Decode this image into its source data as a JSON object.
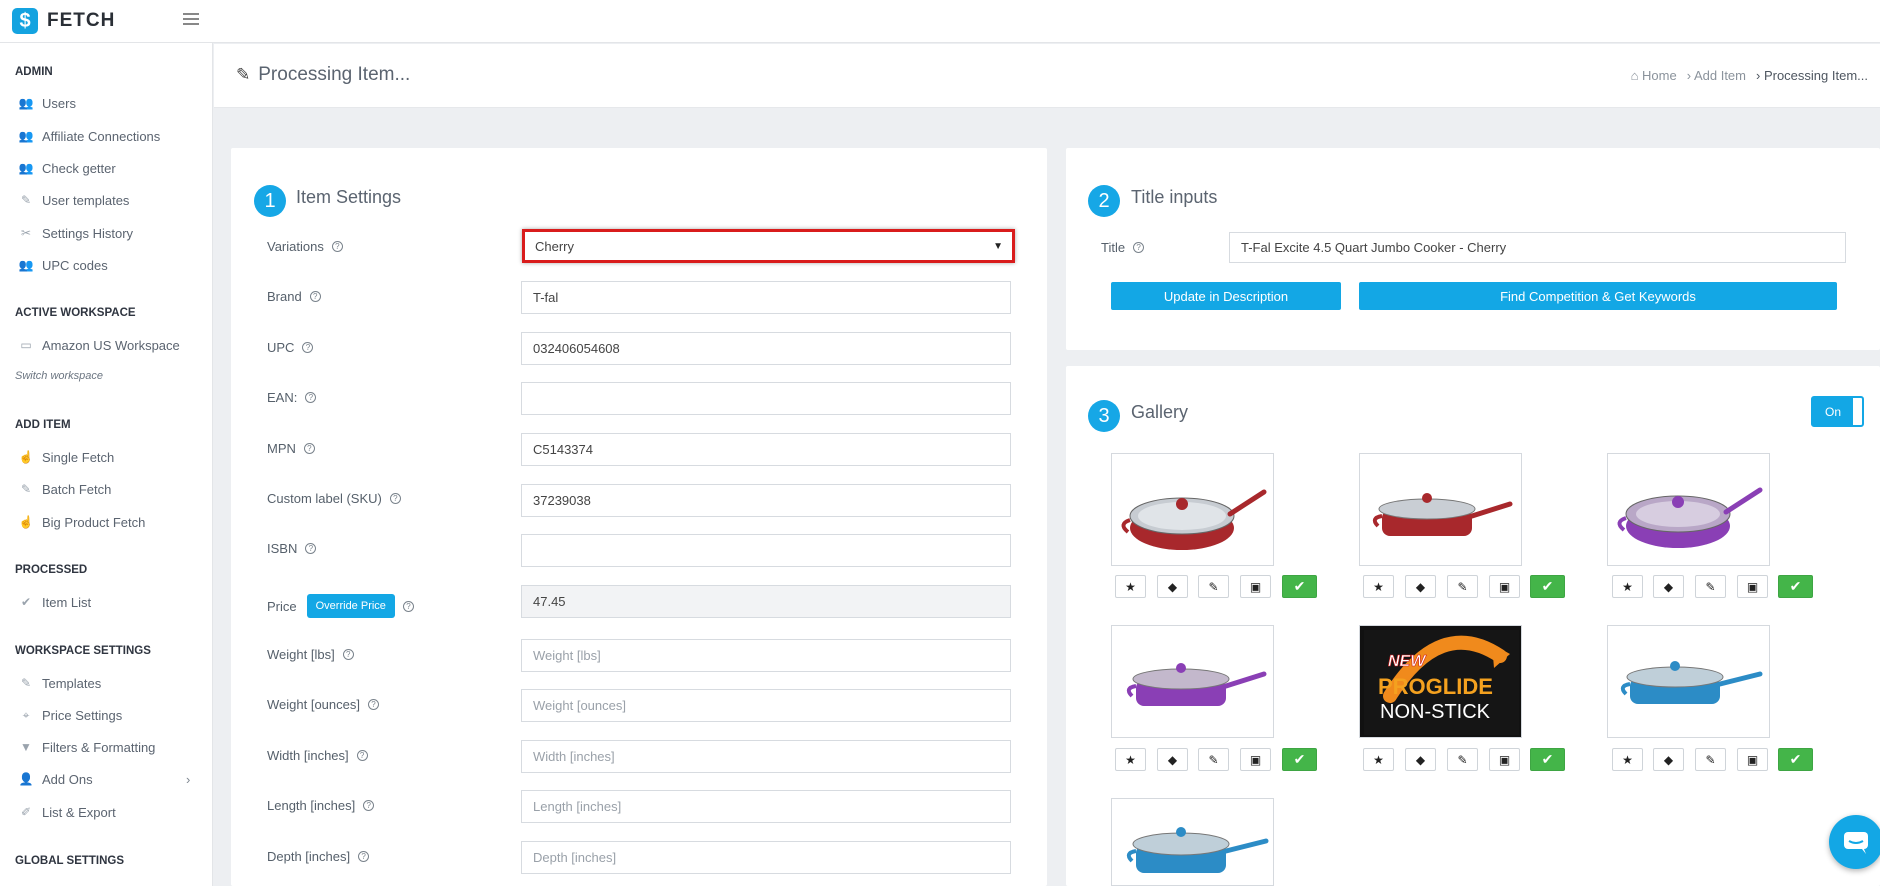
{
  "app": {
    "logo_letter": "$",
    "logo_text": "FETCH"
  },
  "sidebar": {
    "sections": [
      {
        "label": "ADMIN"
      },
      {
        "label": "ACTIVE WORKSPACE"
      },
      {
        "label": "ADD ITEM"
      },
      {
        "label": "PROCESSED"
      },
      {
        "label": "WORKSPACE SETTINGS"
      },
      {
        "label": "GLOBAL SETTINGS"
      }
    ],
    "items": [
      {
        "label": "Users",
        "icon": "users-icon"
      },
      {
        "label": "Affiliate Connections",
        "icon": "users-icon"
      },
      {
        "label": "Check getter",
        "icon": "users-icon"
      },
      {
        "label": "User templates",
        "icon": "brush-icon"
      },
      {
        "label": "Settings History",
        "icon": "tools-icon"
      },
      {
        "label": "UPC codes",
        "icon": "users-icon"
      },
      {
        "label": "Amazon US Workspace",
        "icon": "monitor-icon"
      },
      {
        "label": "Single Fetch",
        "icon": "hand-icon"
      },
      {
        "label": "Batch Fetch",
        "icon": "brush-icon"
      },
      {
        "label": "Big Product Fetch",
        "icon": "hand-icon"
      },
      {
        "label": "Item List",
        "icon": "check-list-icon"
      },
      {
        "label": "Templates",
        "icon": "brush-icon"
      },
      {
        "label": "Price Settings",
        "icon": "tag-icon"
      },
      {
        "label": "Filters & Formatting",
        "icon": "filter-icon"
      },
      {
        "label": "Add Ons",
        "icon": "user-icon"
      },
      {
        "label": "List & Export",
        "icon": "export-icon"
      }
    ],
    "switch_workspace": "Switch workspace"
  },
  "header": {
    "title": "Processing Item...",
    "breadcrumbs": [
      "Home",
      "Add Item",
      "Processing Item..."
    ]
  },
  "item_settings": {
    "step": "1",
    "title": "Item Settings",
    "override_label": "Override Price",
    "fields": [
      {
        "label": "Variations",
        "value": "Cherry"
      },
      {
        "label": "Brand",
        "value": "T-fal"
      },
      {
        "label": "UPC",
        "value": "032406054608"
      },
      {
        "label": "EAN:",
        "value": ""
      },
      {
        "label": "MPN",
        "value": "C5143374"
      },
      {
        "label": "Custom label (SKU)",
        "value": "37239038"
      },
      {
        "label": "ISBN",
        "value": ""
      },
      {
        "label": "Price",
        "value": "47.45"
      },
      {
        "label": "Weight [lbs]",
        "placeholder": "Weight [lbs]"
      },
      {
        "label": "Weight [ounces]",
        "placeholder": "Weight [ounces]"
      },
      {
        "label": "Width [inches]",
        "placeholder": "Width [inches]"
      },
      {
        "label": "Length [inches]",
        "placeholder": "Length [inches]"
      },
      {
        "label": "Depth [inches]",
        "placeholder": "Depth [inches]"
      }
    ]
  },
  "title_inputs": {
    "step": "2",
    "title": "Title inputs",
    "title_label": "Title",
    "title_value": "T-Fal Excite 4.5 Quart Jumbo Cooker - Cherry",
    "update_button": "Update in Description",
    "find_button": "Find Competition & Get Keywords"
  },
  "gallery": {
    "step": "3",
    "title": "Gallery",
    "toggle_label": "On",
    "promo_text": {
      "line1": "NEW",
      "line2": "PROGLIDE",
      "line3": "NON-STICK"
    },
    "images": [
      {
        "subject": "red jumbo cooker with lid",
        "color": "#a8282c"
      },
      {
        "subject": "red jumbo cooker side view",
        "color": "#a8282c"
      },
      {
        "subject": "purple jumbo cooker with lid",
        "color": "#8a3fb5"
      },
      {
        "subject": "purple jumbo cooker side view",
        "color": "#8a3fb5"
      },
      {
        "subject": "ProGlide non-stick badge",
        "color": "#111111"
      },
      {
        "subject": "blue jumbo cooker side view",
        "color": "#2c8cc6"
      },
      {
        "subject": "blue jumbo cooker",
        "color": "#2c8cc6"
      }
    ]
  },
  "colors": {
    "accent": "#13a7e5",
    "highlight": "#d91c1c",
    "success": "#44b549"
  }
}
